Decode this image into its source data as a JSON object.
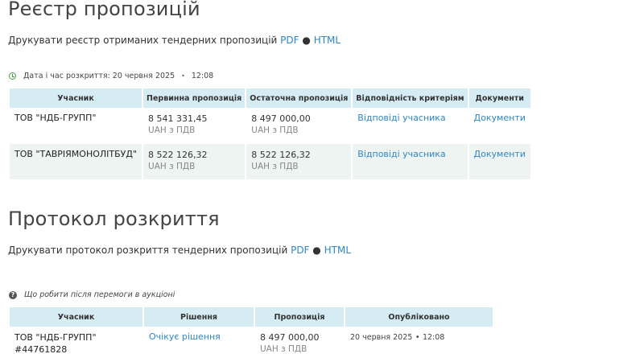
{
  "registry": {
    "title": "Реєстр пропозицій",
    "print_text": "Друкувати реєстр отриманих тендерних пропозицій",
    "pdf_label": "PDF",
    "separator": "●",
    "html_label": "HTML",
    "opening_label": "Дата і час розкриття: 20 червня 2025",
    "opening_time": "12:08",
    "columns": [
      "Учасник",
      "Первинна пропозиція",
      "Остаточна пропозиція",
      "Відповідність критеріям",
      "Документи"
    ],
    "rows": [
      {
        "participant": "ТОВ \"НДБ-ГРУПП\"",
        "initial_amount": "8 541 331,45",
        "initial_vat": "UAH з ПДВ",
        "final_amount": "8 497 000,00",
        "final_vat": "UAH з ПДВ",
        "criteria_link": "Відповіді учасника",
        "docs_link": "Документи"
      },
      {
        "participant": "ТОВ \"ТАВРІЯМОНОЛІТБУД\"",
        "initial_amount": "8 522 126,32",
        "initial_vat": "UAH з ПДВ",
        "final_amount": "8 522 126,32",
        "final_vat": "UAH з ПДВ",
        "criteria_link": "Відповіді учасника",
        "docs_link": "Документи"
      }
    ]
  },
  "protocol": {
    "title": "Протокол розкриття",
    "print_text": "Друкувати протокол розкриття тендерних пропозицій",
    "pdf_label": "PDF",
    "separator": "●",
    "html_label": "HTML",
    "info_link": "Що робити після перемоги в аукціоні",
    "columns": [
      "Учасник",
      "Рішення",
      "Пропозиція",
      "Опубліковано"
    ],
    "rows": [
      {
        "participant": "ТОВ \"НДБ-ГРУПП\"",
        "participant_id": "#44761828",
        "decision": "Очікує рішення",
        "amount": "8 497 000,00",
        "vat": "UAH з ПДВ",
        "published_date": "20 червня 2025",
        "published_time": "12:08"
      }
    ]
  }
}
